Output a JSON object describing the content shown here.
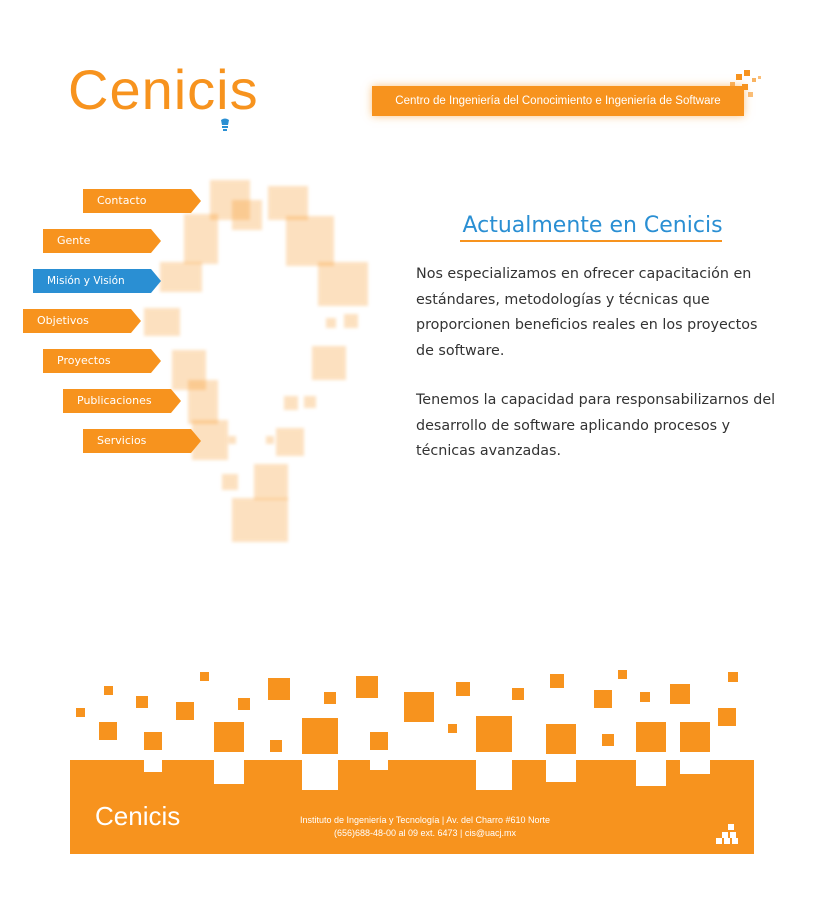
{
  "brand": {
    "logo_text": "Cenicis",
    "tagline": "Centro de Ingeniería del Conocimiento e Ingeniería de Software",
    "accent_color": "#f7931e",
    "active_color": "#2a8fd3"
  },
  "nav": {
    "items": [
      {
        "label": "Contacto",
        "active": false
      },
      {
        "label": "Gente",
        "active": false
      },
      {
        "label": "Misión y Visión",
        "active": true
      },
      {
        "label": "Objetivos",
        "active": false
      },
      {
        "label": "Proyectos",
        "active": false
      },
      {
        "label": "Publicaciones",
        "active": false
      },
      {
        "label": "Servicios",
        "active": false
      }
    ]
  },
  "main": {
    "heading": "Actualmente en Cenicis",
    "paragraphs": [
      "Nos especializamos en ofrecer capacitación en estándares, metodologías y técnicas que proporcionen beneficios reales en los proyectos de software.",
      "Tenemos la capacidad para responsabilizarnos del desarrollo de software aplicando procesos y técnicas avanzadas."
    ]
  },
  "footer": {
    "logo_text": "Cenicis",
    "address_line": "Instituto de Ingeniería y Tecnología | Av. del Charro #610 Norte",
    "contact_line": "(656)688-48-00 al 09 ext. 6473 | cis@uacj.mx"
  }
}
